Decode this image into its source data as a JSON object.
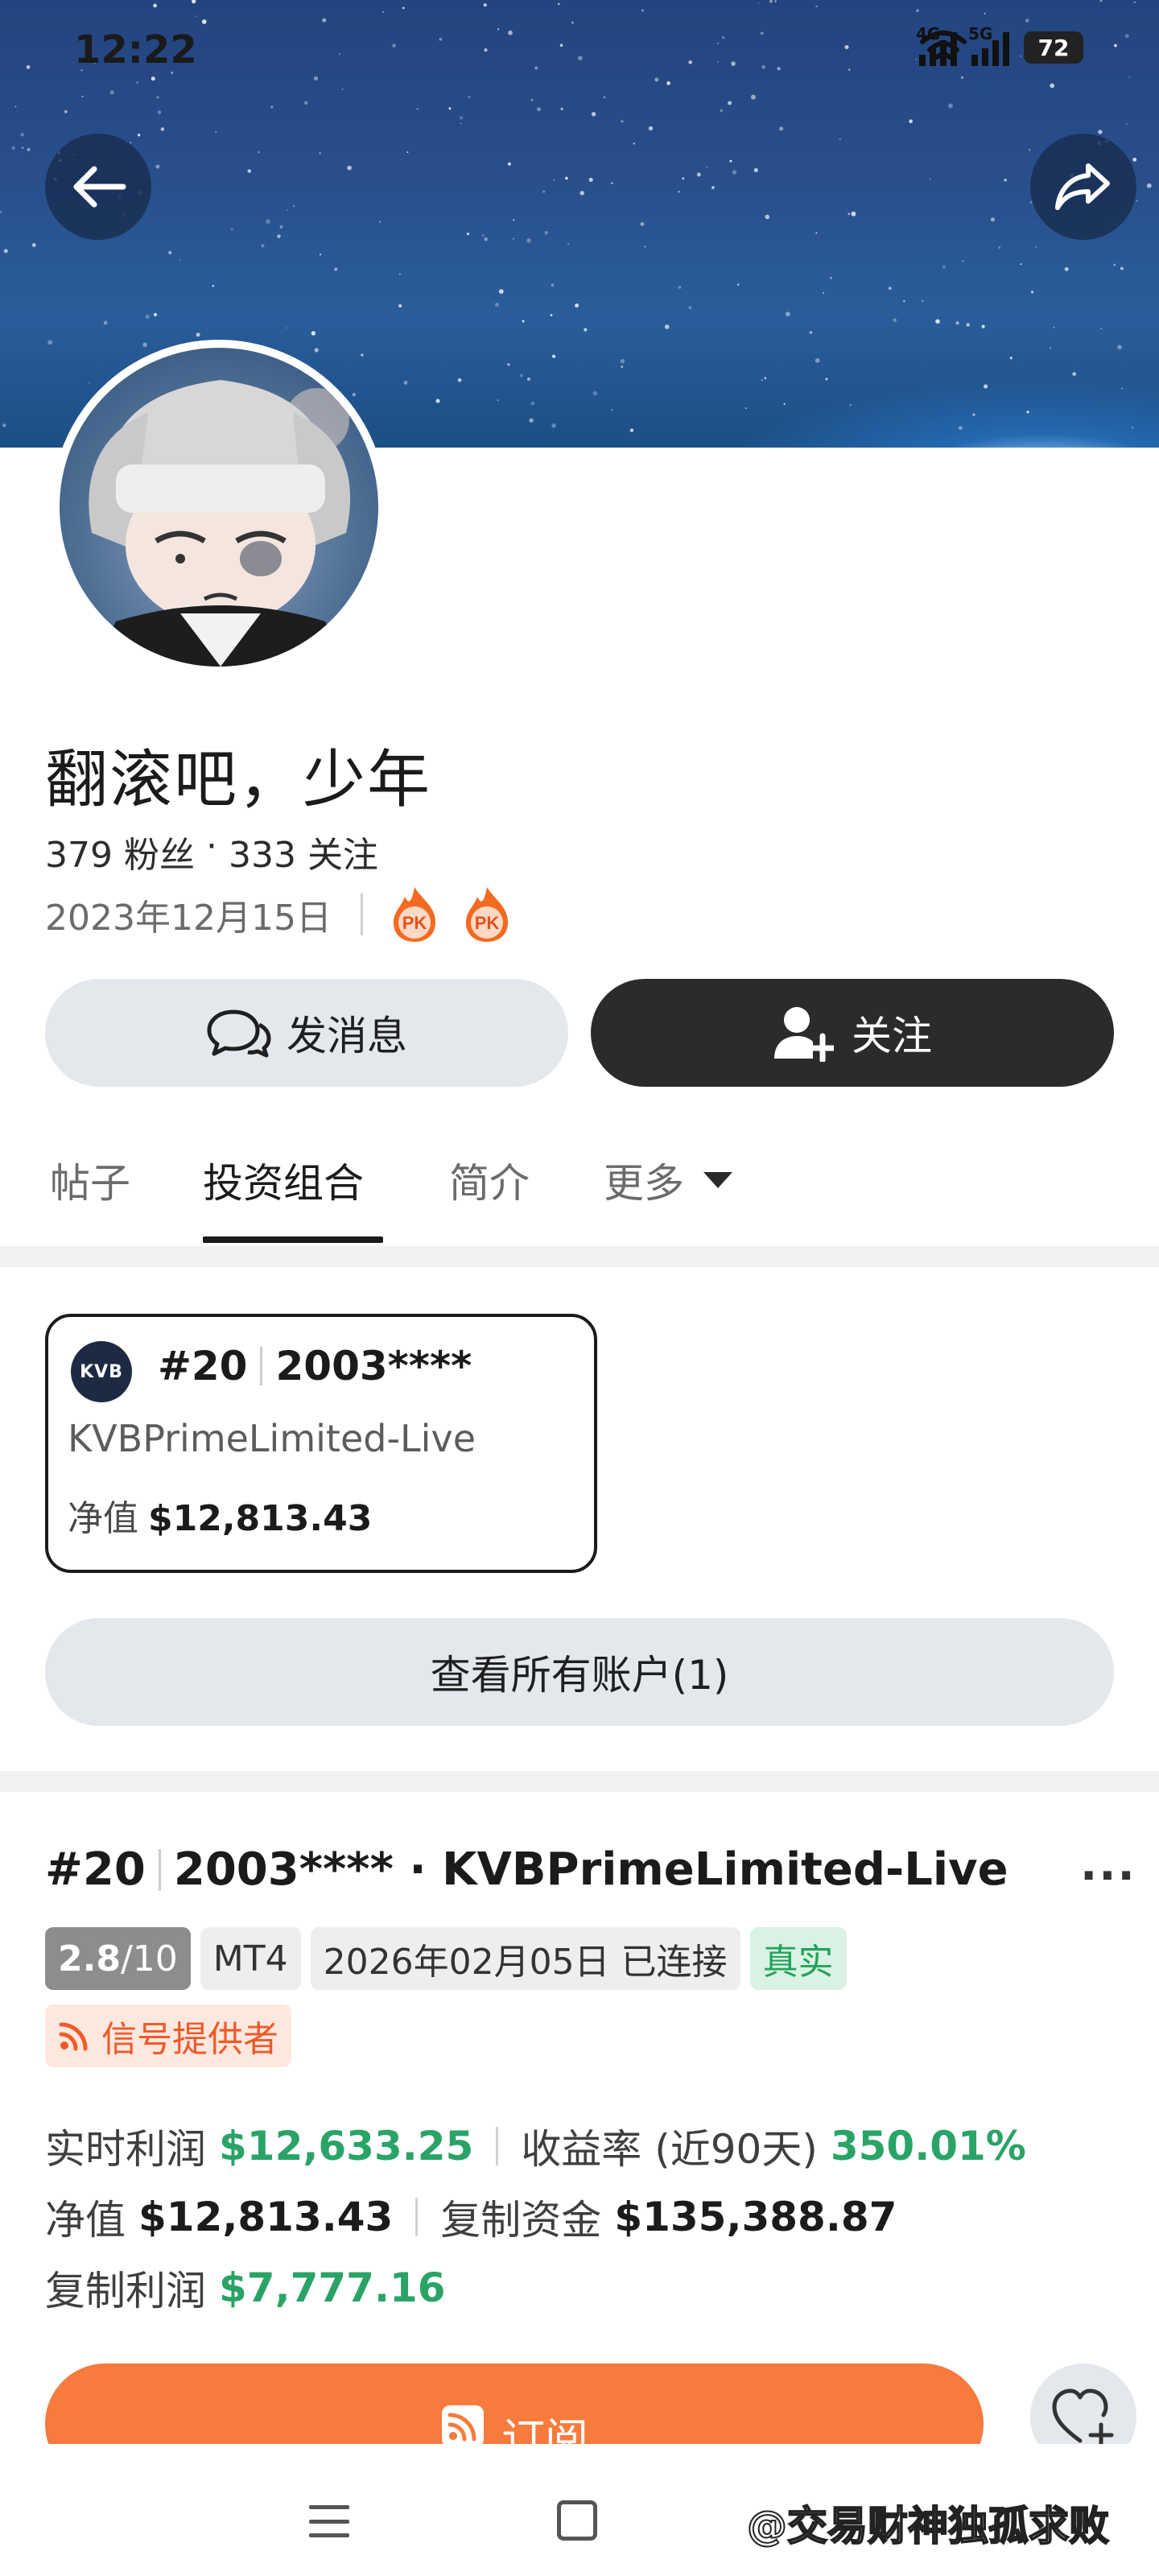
{
  "status_bar": {
    "time": "12:22",
    "signal_1_tag": "4G",
    "signal_2_tag": "5G",
    "battery": "72"
  },
  "header": {
    "back_icon": "arrow-left-icon",
    "share_icon": "share-icon"
  },
  "profile": {
    "name": "翻滚吧，少年",
    "followers": "379 粉丝",
    "dot": "·",
    "following": "333 关注",
    "join_date": "2023年12月15日",
    "badges": [
      "pk-badge-icon",
      "pk-badge-icon"
    ],
    "badge_text": "PK"
  },
  "actions": {
    "message_label": "发消息",
    "follow_label": "关注"
  },
  "tabs": [
    {
      "label": "帖子",
      "active": false
    },
    {
      "label": "投资组合",
      "active": true
    },
    {
      "label": "简介",
      "active": false
    },
    {
      "label": "更多",
      "active": false
    }
  ],
  "account_card": {
    "logo_text": "KVB",
    "rank": "#20",
    "account_no": "2003****",
    "broker": "KVBPrimeLimited-Live",
    "equity_label": "净值",
    "equity_value": "$12,813.43"
  },
  "view_all_label": "查看所有账户(1)",
  "detail": {
    "rank": "#20",
    "title_rest": "2003**** · KVBPrimeLimited-Live",
    "more_label": "···",
    "score": "2.8",
    "score_max": "/10",
    "platform": "MT4",
    "connected": "2026年02月05日 已连接",
    "real_tag": "真实",
    "signal_tag": "信号提供者",
    "metrics": {
      "realtime_profit_label": "实时利润",
      "realtime_profit_value": "$12,633.25",
      "return_label": "收益率 (近90天)",
      "return_value": "350.01%",
      "equity_label": "净值",
      "equity_value": "$12,813.43",
      "copy_funds_label": "复制资金",
      "copy_funds_value": "$135,388.87",
      "copy_profit_label": "复制利润",
      "copy_profit_value": "$7,777.16"
    },
    "subscribe_label": "订阅"
  },
  "colors": {
    "accent_orange": "#f77b3d",
    "profit_green": "#2aa367",
    "dark_button": "#2b2b2b",
    "light_button": "#e4e8ec"
  },
  "bottom_nav": {
    "watermark": "@交易财神独孤求败"
  }
}
